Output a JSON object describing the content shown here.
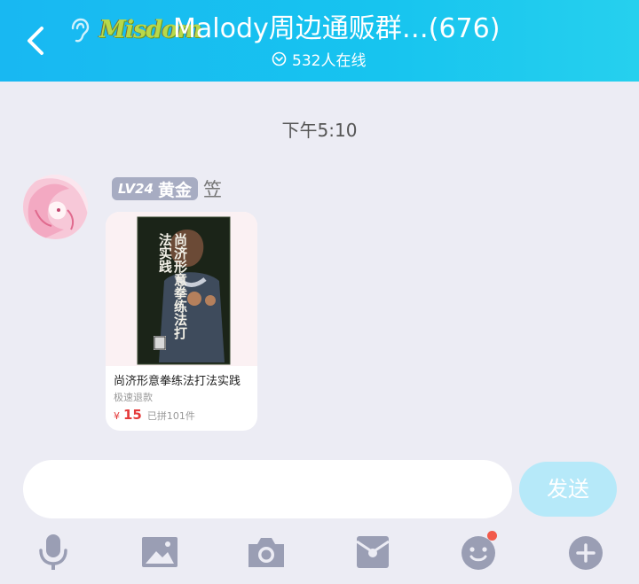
{
  "header": {
    "logo_text": "Misdom",
    "title": "Malody周边通贩群…(676)",
    "online_text": "532人在线"
  },
  "chat": {
    "timestamp": "下午5:10",
    "message": {
      "badge_level": "LV24",
      "badge_rank": "黄金",
      "sender_name": "笠",
      "product": {
        "name": "尚济形意拳练法打法实践",
        "subtitle": "极速退款",
        "currency": "¥",
        "price": "15",
        "sold_text": "已拼101件",
        "cover_title": "尚济形意拳练法打法实践"
      }
    }
  },
  "input": {
    "placeholder": "",
    "send_label": "发送"
  },
  "toolbar": {
    "items": [
      "microphone-icon",
      "image-icon",
      "camera-icon",
      "red-packet-icon",
      "emoji-icon",
      "plus-icon"
    ],
    "emoji_notification": true
  },
  "colors": {
    "header_gradient_start": "#18b8f2",
    "header_gradient_end": "#26d0ee",
    "background": "#ececf4",
    "price_red": "#e43a3a",
    "send_button": "#b6e9f9",
    "icon_gray": "#9a9eb4"
  }
}
